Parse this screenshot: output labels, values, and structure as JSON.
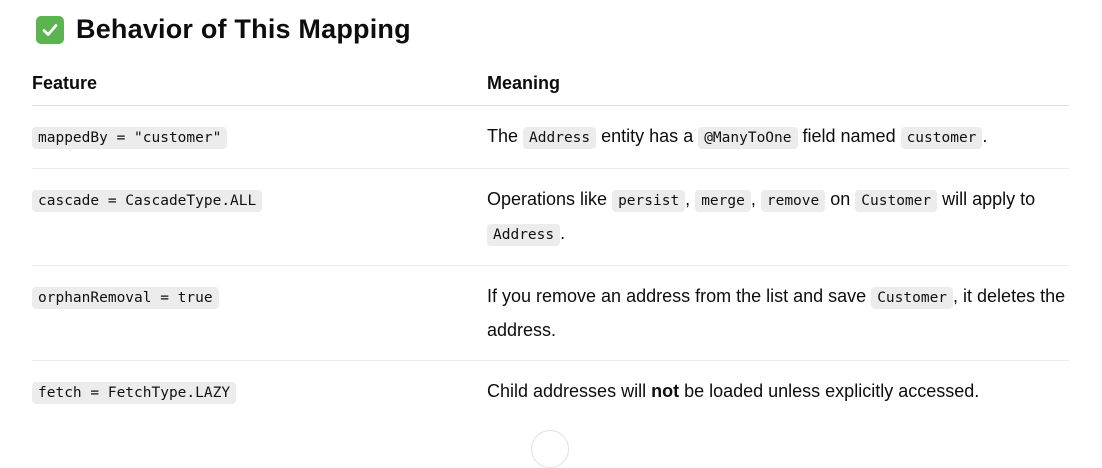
{
  "heading": {
    "icon": "check-mark-icon",
    "text": "Behavior of This Mapping"
  },
  "table": {
    "headers": {
      "feature": "Feature",
      "meaning": "Meaning"
    },
    "rows": [
      {
        "feature": "mappedBy = \"customer\"",
        "meaning": [
          {
            "t": "The "
          },
          {
            "c": "Address"
          },
          {
            "t": " entity has a "
          },
          {
            "c": "@ManyToOne"
          },
          {
            "t": " field named "
          },
          {
            "c": "customer"
          },
          {
            "t": "."
          }
        ]
      },
      {
        "feature": "cascade = CascadeType.ALL",
        "meaning": [
          {
            "t": "Operations like "
          },
          {
            "c": "persist"
          },
          {
            "t": ", "
          },
          {
            "c": "merge"
          },
          {
            "t": ", "
          },
          {
            "c": "remove"
          },
          {
            "t": " on "
          },
          {
            "c": "Customer"
          },
          {
            "t": " will apply to "
          },
          {
            "c": "Address"
          },
          {
            "t": "."
          }
        ]
      },
      {
        "feature": "orphanRemoval = true",
        "meaning": [
          {
            "t": "If you remove an address from the list and save "
          },
          {
            "c": "Customer"
          },
          {
            "t": ", it deletes the address."
          }
        ]
      },
      {
        "feature": "fetch = FetchType.LAZY",
        "meaning": [
          {
            "t": "Child addresses will "
          },
          {
            "b": "not"
          },
          {
            "t": " be loaded unless explicitly accessed."
          }
        ]
      }
    ]
  },
  "colors": {
    "check_icon_bg": "#5bb450",
    "code_bg": "#ececec"
  }
}
